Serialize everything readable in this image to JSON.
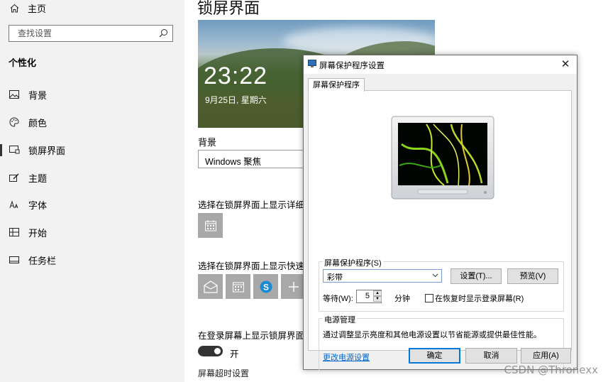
{
  "sidebar": {
    "home_label": "主页",
    "search_placeholder": "查找设置",
    "section_title": "个性化",
    "items": [
      {
        "label": "背景",
        "icon": "picture-icon"
      },
      {
        "label": "颜色",
        "icon": "palette-icon"
      },
      {
        "label": "锁屏界面",
        "icon": "lock-screen-icon",
        "active": true
      },
      {
        "label": "主题",
        "icon": "theme-brush-icon"
      },
      {
        "label": "字体",
        "icon": "font-icon"
      },
      {
        "label": "开始",
        "icon": "start-grid-icon"
      },
      {
        "label": "任务栏",
        "icon": "taskbar-icon"
      }
    ]
  },
  "main": {
    "title": "锁屏界面",
    "preview": {
      "time": "23:22",
      "date": "9月25日, 星期六"
    },
    "background_label": "背景",
    "background_value": "Windows 聚焦",
    "detail_status_label": "选择在锁屏界面上显示详细状",
    "quick_status_label": "选择在锁屏界面上显示快速状",
    "quick_icons": [
      "mail-icon",
      "calendar-icon",
      "skype-icon",
      "plus-icon"
    ],
    "login_bg_label": "在登录屏幕上显示锁屏界面背",
    "toggle_state": "开",
    "timeout_label": "屏幕超时设置"
  },
  "dialog": {
    "title": "屏幕保护程序设置",
    "close": "✕",
    "tab_label": "屏幕保护程序",
    "screensaver_group_label": "屏幕保护程序(S)",
    "screensaver_value": "彩带",
    "settings_button": "设置(T)...",
    "preview_button": "预览(V)",
    "wait_label": "等待(W):",
    "wait_value": "5",
    "minutes_label": "分钟",
    "resume_checkbox_label": "在恢复时显示登录屏幕(R)",
    "resume_checked": false,
    "power_group_label": "电源管理",
    "power_description": "通过调整显示亮度和其他电源设置以节省能源或提供最佳性能。",
    "power_link": "更改电源设置",
    "ok_button": "确定",
    "cancel_button": "取消",
    "apply_button": "应用(A)"
  },
  "watermark": "CSDN @Thronexx",
  "colors": {
    "accent": "#0078d7",
    "link": "#0066cc",
    "sidebar_bg": "#f2f2f2",
    "tile_gray": "#a8a8a8"
  }
}
